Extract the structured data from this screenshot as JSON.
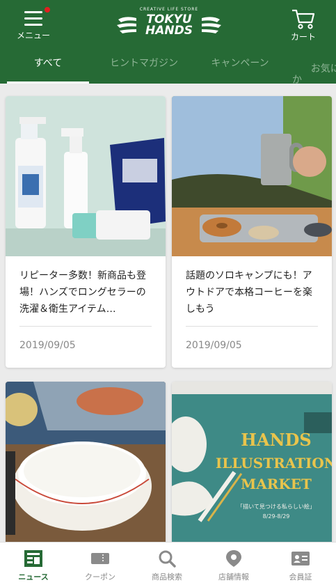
{
  "header": {
    "menu_label": "メニュー",
    "logo_tagline": "CREATIVE LIFE STORE",
    "logo_line1": "TOKYU",
    "logo_line2": "HANDS",
    "cart_label": "カート"
  },
  "tabs": [
    {
      "label": "すべて"
    },
    {
      "label": "ヒントマガジン"
    },
    {
      "label": "キャンペーン"
    },
    {
      "label": "お気に入\nか"
    }
  ],
  "articles": [
    {
      "title": "リピーター多数！新商品も登場！ハンズでロングセラーの洗濯＆衛生アイテム…",
      "date": "2019/09/05"
    },
    {
      "title": "話題のソロキャンプにも！アウトドアで本格コーヒーを楽しもう",
      "date": "2019/09/05"
    },
    {
      "title": "",
      "date": ""
    },
    {
      "title": "",
      "date": "",
      "image_text_1": "HANDS",
      "image_text_2": "ILLUSTRATION",
      "image_text_3": "MARKET",
      "image_text_4": "「描いて見つける私らしい絵」",
      "image_text_5": "8/29-8/29"
    }
  ],
  "bottom_nav": [
    {
      "label": "ニュース",
      "icon": "news-icon"
    },
    {
      "label": "クーポン",
      "icon": "coupon-icon"
    },
    {
      "label": "商品検索",
      "icon": "search-icon"
    },
    {
      "label": "店舗情報",
      "icon": "location-pin-icon"
    },
    {
      "label": "会員証",
      "icon": "member-card-icon"
    }
  ],
  "colors": {
    "header_green": "#266a35",
    "active_nav": "#266a35"
  }
}
